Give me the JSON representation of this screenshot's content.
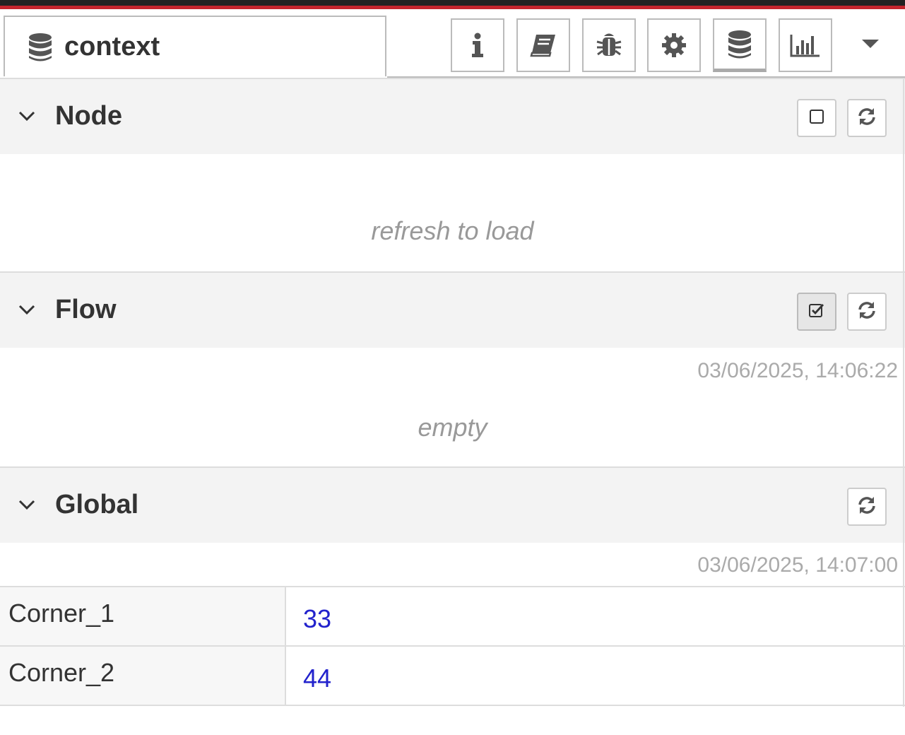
{
  "sidebar_tab": {
    "label": "context",
    "icon": "database-icon"
  },
  "toolbar_tabs": [
    {
      "name": "info",
      "icon": "info-icon"
    },
    {
      "name": "help",
      "icon": "book-icon"
    },
    {
      "name": "debug",
      "icon": "bug-icon"
    },
    {
      "name": "config",
      "icon": "gear-icon"
    },
    {
      "name": "context",
      "icon": "database-icon",
      "active": true
    },
    {
      "name": "dashboard",
      "icon": "bar-chart-icon"
    }
  ],
  "sections": {
    "node": {
      "title": "Node",
      "placeholder": "refresh to load"
    },
    "flow": {
      "title": "Flow",
      "timestamp": "03/06/2025, 14:06:22",
      "placeholder": "empty"
    },
    "global": {
      "title": "Global",
      "timestamp": "03/06/2025, 14:07:00",
      "entries": [
        {
          "key": "Corner_1",
          "value": "33"
        },
        {
          "key": "Corner_2",
          "value": "44"
        }
      ]
    }
  },
  "colors": {
    "accent_red": "#c4252d",
    "value_blue": "#2222cc",
    "header_bg": "#f3f3f3"
  }
}
